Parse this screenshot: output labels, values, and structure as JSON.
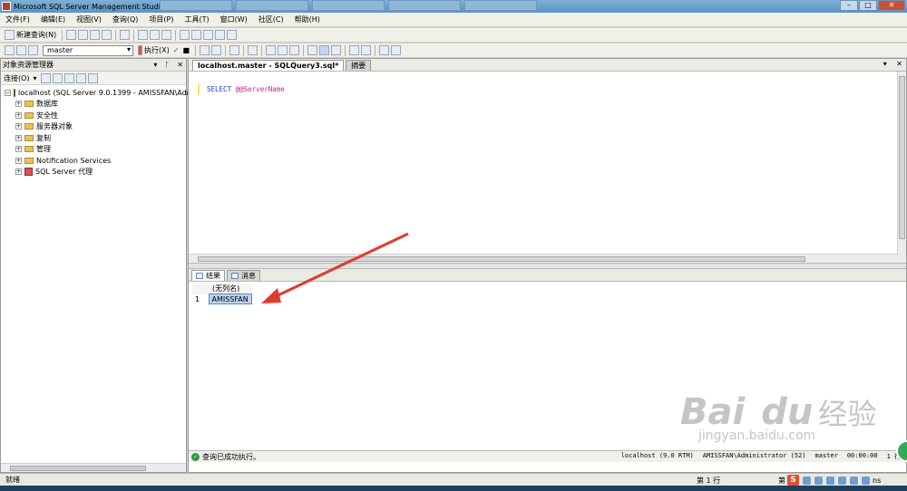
{
  "window": {
    "title": "Microsoft SQL Server Management Studio"
  },
  "menu": [
    "文件(F)",
    "编辑(E)",
    "视图(V)",
    "查询(Q)",
    "项目(P)",
    "工具(T)",
    "窗口(W)",
    "社区(C)",
    "帮助(H)"
  ],
  "toolbar1": {
    "new_query": "新建查询(N)"
  },
  "toolbar2": {
    "database": "master",
    "execute": "执行(X)"
  },
  "object_explorer": {
    "title": "对象资源管理器",
    "connect": "连接(O)",
    "server_node": "localhost (SQL Server 9.0.1399 - AMISSFAN\\Adm",
    "children": [
      "数据库",
      "安全性",
      "服务器对象",
      "复制",
      "管理",
      "Notification Services",
      "SQL Server 代理"
    ]
  },
  "editor": {
    "tab_label": "localhost.master - SQLQuery3.sql*",
    "summary_tab": "摘要",
    "code_keyword": "SELECT",
    "code_variable": "@@ServerName"
  },
  "results": {
    "tab_results": "结果",
    "tab_messages": "消息",
    "column_header": "(无列名)",
    "rows": [
      {
        "num": "1",
        "value": "AMISSFAN"
      }
    ]
  },
  "query_status": {
    "message": "查询已成功执行。",
    "server": "localhost (9.0 RTM)",
    "user": "AMISSFAN\\Administrator (52)",
    "database": "master",
    "elapsed": "00:00:00",
    "rows": "1 行"
  },
  "statusbar": {
    "ready": "就绪",
    "line": "第 1 行",
    "column_prefix": "第",
    "ime_label": "S",
    "ime_extra": "ns"
  },
  "watermark": {
    "logo_text": "Bai",
    "logo_text2": "du",
    "experience": "经验",
    "url": "jingyan.baidu.com"
  }
}
